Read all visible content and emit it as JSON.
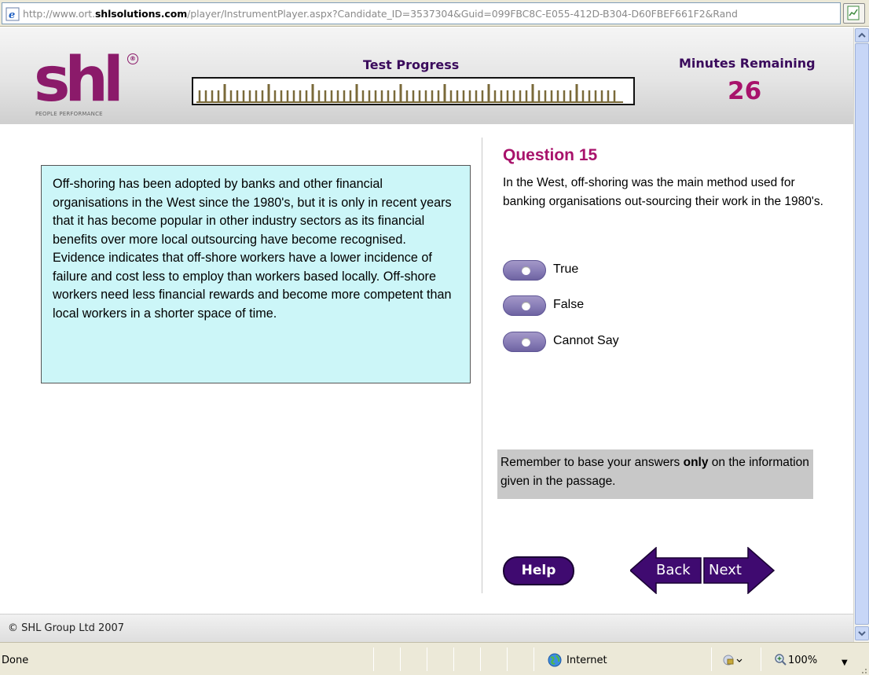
{
  "browser": {
    "url_prefix": "http://www.ort.",
    "url_domain": "shlsolutions.com",
    "url_suffix": "/player/InstrumentPlayer.aspx?Candidate_ID=3537304&Guid=099FBC8C-E055-412D-B304-D60FBEF661F2&Rand",
    "status_text": "Done",
    "zone": "Internet",
    "zoom": "100%"
  },
  "header": {
    "logo_text": "shl",
    "logo_registered": "®",
    "logo_tagline": "PEOPLE PERFORMANCE",
    "progress_label": "Test Progress",
    "progress_fraction": 0.97,
    "time_label": "Minutes Remaining",
    "time_value": "26"
  },
  "passage": {
    "text": "Off-shoring has been adopted by banks and other financial organisations in the West since the 1980's, but it is only in recent years that it has become popular in other industry sectors as its financial benefits over more local outsourcing have become recognised. Evidence indicates that off-shore workers have a lower incidence of failure and cost less to employ than workers based locally. Off-shore workers need less financial rewards and become more competent than local workers in a shorter space of time."
  },
  "question": {
    "title": "Question 15",
    "text": "In the West, off-shoring was the main method used for banking organisations out-sourcing their work in the 1980's.",
    "options": [
      {
        "label": "True"
      },
      {
        "label": "False"
      },
      {
        "label": "Cannot Say"
      }
    ]
  },
  "reminder": {
    "part1": "Remember to base your answers ",
    "bold": "only",
    "part2": " on the information given in the passage."
  },
  "buttons": {
    "help": "Help",
    "back": "Back",
    "next": "Next"
  },
  "footer": {
    "copyright": "© SHL Group Ltd 2007"
  },
  "colors": {
    "brand_purple": "#3f0a70",
    "accent_magenta": "#a8126b",
    "passage_bg": "#ccf6f8"
  },
  "icons": [
    "ie-page-icon",
    "rss-feed-icon",
    "internet-zone-icon",
    "protected-mode-icon",
    "zoom-icon"
  ]
}
